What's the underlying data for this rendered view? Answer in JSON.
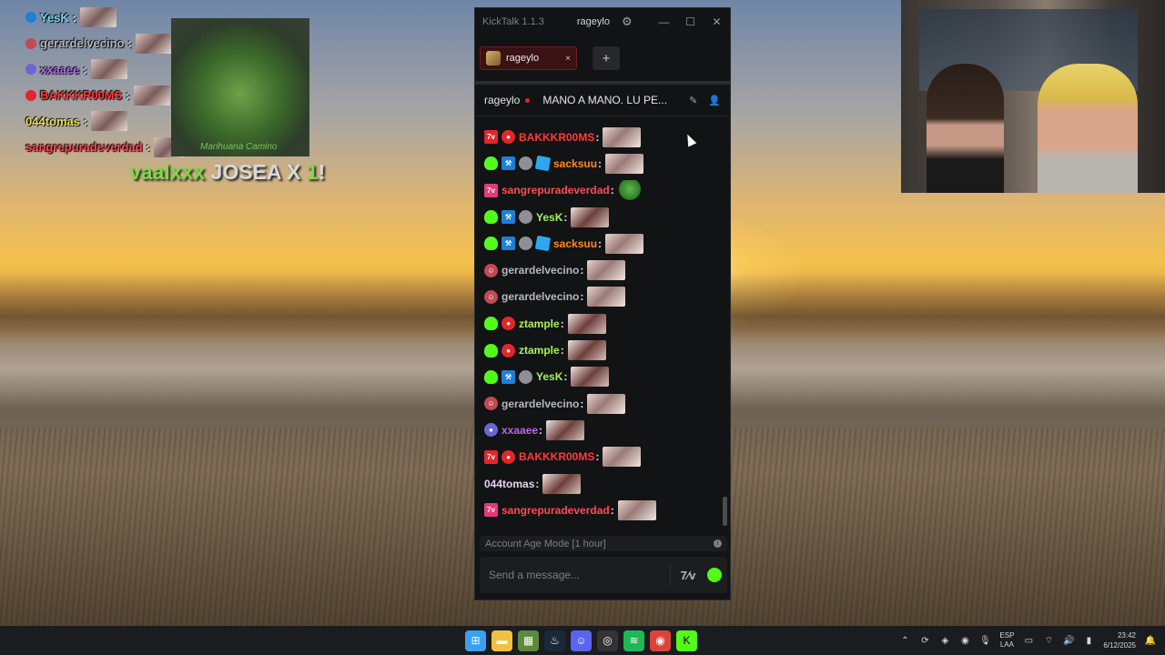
{
  "desktop": {
    "overlay_chat": [
      {
        "username": "YesK",
        "color": "#7fd6f0",
        "badge_color": "#1e7fd6"
      },
      {
        "username": "gerardelvecino",
        "color": "#b5b7bb",
        "badge_color": "#c24a52"
      },
      {
        "username": "xxaaee",
        "color": "#b06de0",
        "badge_color": "#6b66d6"
      },
      {
        "username": "BAKKKR00MS",
        "color": "#ff3a3a",
        "badge_color": "#e2262a"
      },
      {
        "username": "044tomas",
        "color": "#e8e060",
        "badge_color": ""
      },
      {
        "username": "sangrepuradeverdad",
        "color": "#ff4a5a",
        "badge_color": ""
      }
    ],
    "overlay_image_caption": "Marihuana Camino",
    "overlay_big_message": {
      "user": "vaalxxx",
      "text": "JOSEA X",
      "number": "1",
      "suffix": "!"
    }
  },
  "kicktalk": {
    "app_title": "KickTalk 1.1.3",
    "current_user": "rageylo",
    "tab": {
      "label": "rageylo",
      "close": "×"
    },
    "add_tab": "+",
    "channel": {
      "name": "rageylo",
      "title": "MANO A MANO. LU PE..."
    },
    "messages": [
      {
        "badges": [
          "gift",
          "fire"
        ],
        "username": "BAKKKR00MS",
        "color": "#ff3a3a",
        "emote": "light"
      },
      {
        "badges": [
          "alien",
          "hammer",
          "globe",
          "cube"
        ],
        "username": "sacksuu",
        "color": "#ff8a1c",
        "emote": "light"
      },
      {
        "badges": [
          "crown"
        ],
        "username": "sangrepuradeverdad",
        "color": "#ff4a5a",
        "emote": "pepe"
      },
      {
        "badges": [
          "alien",
          "hammer",
          "globe"
        ],
        "username": "YesK",
        "color": "#a8f060",
        "emote": "dark"
      },
      {
        "badges": [
          "alien",
          "hammer",
          "globe",
          "cube"
        ],
        "username": "sacksuu",
        "color": "#ff8a1c",
        "emote": "light"
      },
      {
        "badges": [
          "mask"
        ],
        "username": "gerardelvecino",
        "color": "#b5b7bb",
        "emote": "light"
      },
      {
        "badges": [
          "mask"
        ],
        "username": "gerardelvecino",
        "color": "#b5b7bb",
        "emote": "light"
      },
      {
        "badges": [
          "alien",
          "fire"
        ],
        "username": "ztample",
        "color": "#a8f060",
        "emote": "dark"
      },
      {
        "badges": [
          "alien",
          "fire"
        ],
        "username": "ztample",
        "color": "#a8f060",
        "emote": "dark"
      },
      {
        "badges": [
          "alien",
          "hammer",
          "globe"
        ],
        "username": "YesK",
        "color": "#a8f060",
        "emote": "dark"
      },
      {
        "badges": [
          "mask"
        ],
        "username": "gerardelvecino",
        "color": "#b5b7bb",
        "emote": "light"
      },
      {
        "badges": [
          "shield"
        ],
        "username": "xxaaee",
        "color": "#b06de0",
        "emote": "dark"
      },
      {
        "badges": [
          "gift",
          "fire"
        ],
        "username": "BAKKKR00MS",
        "color": "#ff3a3a",
        "emote": "light"
      },
      {
        "badges": [],
        "username": "044tomas",
        "color": "#e8d0f0",
        "emote": "dark"
      },
      {
        "badges": [
          "crown"
        ],
        "username": "sangrepuradeverdad",
        "color": "#ff4a5a",
        "emote": "light"
      }
    ],
    "account_age_mode": "Account Age Mode [1 hour]",
    "input_placeholder": "Send a message...",
    "emote_button": "7⁄v"
  },
  "taskbar": {
    "apps": [
      "start",
      "file-explorer",
      "minecraft",
      "steam",
      "discord",
      "obs",
      "spotify",
      "chrome",
      "kick"
    ],
    "lang_top": "ESP",
    "lang_bottom": "LAA",
    "time": "23:42",
    "date": "6/12/2025"
  }
}
